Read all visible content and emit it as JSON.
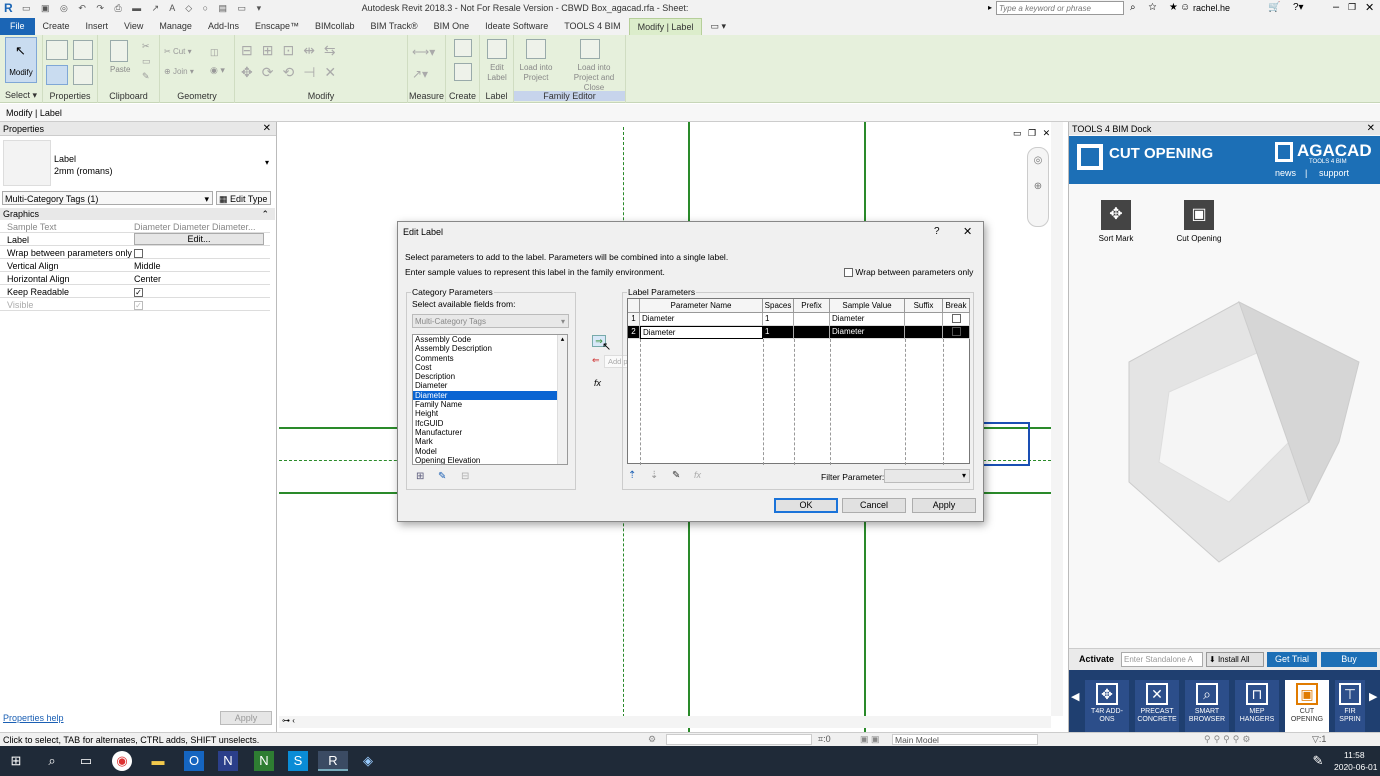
{
  "app": {
    "title": "Autodesk Revit 2018.3 - Not For Resale Version -  CBWD Box_agacad.rfa - Sheet:",
    "search_placeholder": "Type a keyword or phrase",
    "user": "rachel.he"
  },
  "menu": [
    "File",
    "Create",
    "Insert",
    "View",
    "Manage",
    "Add-Ins",
    "Enscape™",
    "BIMcollab",
    "BIM Track®",
    "BIM One",
    "Ideate Software",
    "TOOLS 4 BIM",
    "Modify | Label"
  ],
  "ribbon": {
    "panels": [
      "Select",
      "Properties",
      "Clipboard",
      "Geometry",
      "Modify",
      "Measure",
      "Create",
      "Label",
      "Family Editor"
    ],
    "modify": "Modify",
    "paste": "Paste",
    "cut": "Cut",
    "join": "Join",
    "edit_label": "Edit Label",
    "load_into": "Load into Project",
    "load_close": "Load into Project and Close"
  },
  "options_bar": "Modify | Label",
  "properties": {
    "title": "Properties",
    "type_name": "Label",
    "type_sub": "2mm (romans)",
    "selector": "Multi-Category Tags (1)",
    "edit_type": "Edit Type",
    "group": "Graphics",
    "rows": [
      {
        "k": "Sample Text",
        "v": "Diameter Diameter Diameter..."
      },
      {
        "k": "Label",
        "v": "Edit..."
      },
      {
        "k": "Wrap between parameters only",
        "v": ""
      },
      {
        "k": "Vertical Align",
        "v": "Middle"
      },
      {
        "k": "Horizontal Align",
        "v": "Center"
      },
      {
        "k": "Keep Readable",
        "v": "✓"
      },
      {
        "k": "Visible",
        "v": "✓"
      }
    ],
    "help": "Properties help",
    "apply": "Apply"
  },
  "dialog": {
    "title": "Edit Label",
    "help": "?",
    "info1": "Select parameters to add to the label.  Parameters will be combined into a single label.",
    "info2": "Enter sample values to represent this label in the family environment.",
    "wrap": "Wrap between parameters only",
    "cat_group": "Category Parameters",
    "select_from": "Select available fields from:",
    "category": "Multi-Category Tags",
    "fields": [
      "Assembly Code",
      "Assembly Description",
      "Comments",
      "Cost",
      "Description",
      "Diameter",
      "Diameter",
      "Family Name",
      "Height",
      "IfcGUID",
      "Manufacturer",
      "Mark",
      "Model",
      "Opening Elevation"
    ],
    "selected_index": 6,
    "tooltip": "Add parameter(s) to label",
    "label_group": "Label Parameters",
    "columns": [
      "Parameter Name",
      "Spaces",
      "Prefix",
      "Sample Value",
      "Suffix",
      "Break"
    ],
    "rows": [
      {
        "n": "1",
        "name": "Diameter",
        "spaces": "1",
        "prefix": "",
        "sample": "Diameter",
        "suffix": ""
      },
      {
        "n": "2",
        "name": "Diameter",
        "spaces": "1",
        "prefix": "",
        "sample": "Diameter",
        "suffix": ""
      }
    ],
    "filter_label": "Filter Parameter:",
    "ok": "OK",
    "cancel": "Cancel",
    "apply": "Apply"
  },
  "dock": {
    "title": "TOOLS 4 BIM Dock",
    "product": "CUT OPENING",
    "brand": "AGACAD",
    "brand_sub": "TOOLS 4 BIM",
    "news": "news",
    "sep": "|",
    "support": "support",
    "tools": [
      "Sort Mark",
      "Cut Opening"
    ],
    "activate": "Activate",
    "standalone_placeholder": "Enter Standalone A",
    "install_all": "Install All",
    "get_trial": "Get Trial",
    "buy": "Buy",
    "tiles": [
      "T4R ADD-ONS",
      "PRECAST CONCRETE",
      "SMART BROWSER",
      "MEP HANGERS",
      "CUT OPENING",
      "FIR SPRIN"
    ]
  },
  "status": {
    "text": "Click to select, TAB for alternates, CTRL adds, SHIFT unselects.",
    "zero": ":0",
    "model": "Main Model",
    "filter": ":1"
  },
  "clock": {
    "time": "11:58",
    "date": "2020-06-01"
  }
}
